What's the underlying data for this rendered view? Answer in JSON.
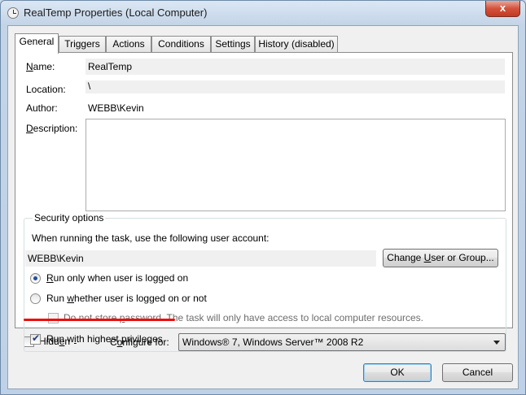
{
  "window": {
    "title": "RealTemp Properties (Local Computer)",
    "close_label": "x"
  },
  "tabs": [
    {
      "label": "General",
      "active": true
    },
    {
      "label": "Triggers"
    },
    {
      "label": "Actions"
    },
    {
      "label": "Conditions"
    },
    {
      "label": "Settings"
    },
    {
      "label": "History (disabled)"
    }
  ],
  "general": {
    "name_label_key": "N",
    "name_label_rest": "ame:",
    "name_value": "RealTemp",
    "location_label": "Location:",
    "location_value": "\\",
    "author_label": "Author:",
    "author_value": "WEBB\\Kevin",
    "description_label_key": "D",
    "description_label_rest": "escription:",
    "description_value": ""
  },
  "security": {
    "title": "Security options",
    "account_prompt": "When running the task, use the following user account:",
    "account_value": "WEBB\\Kevin",
    "change_button_pre": "Change ",
    "change_button_key": "U",
    "change_button_post": "ser or Group...",
    "radio_logged_on_key": "R",
    "radio_logged_on_rest": "un only when user is logged on",
    "radio_whether_pre": "Run ",
    "radio_whether_key": "w",
    "radio_whether_post": "hether user is logged on or not",
    "no_store_pre": "Do not store ",
    "no_store_key": "p",
    "no_store_post": "assword.  The task will only have access to local computer resources.",
    "highest_pre": "Run w",
    "highest_key": "i",
    "highest_post": "th highest privileges"
  },
  "bottom": {
    "hidden_pre": "Hidd",
    "hidden_key": "e",
    "hidden_post": "n",
    "configure_pre": "C",
    "configure_key": "o",
    "configure_post": "nfigure for:",
    "configure_value": "Windows® 7, Windows Server™ 2008 R2",
    "ok_label": "OK",
    "cancel_label": "Cancel"
  },
  "colors": {
    "highlight_underline": "#ee0d0d"
  }
}
